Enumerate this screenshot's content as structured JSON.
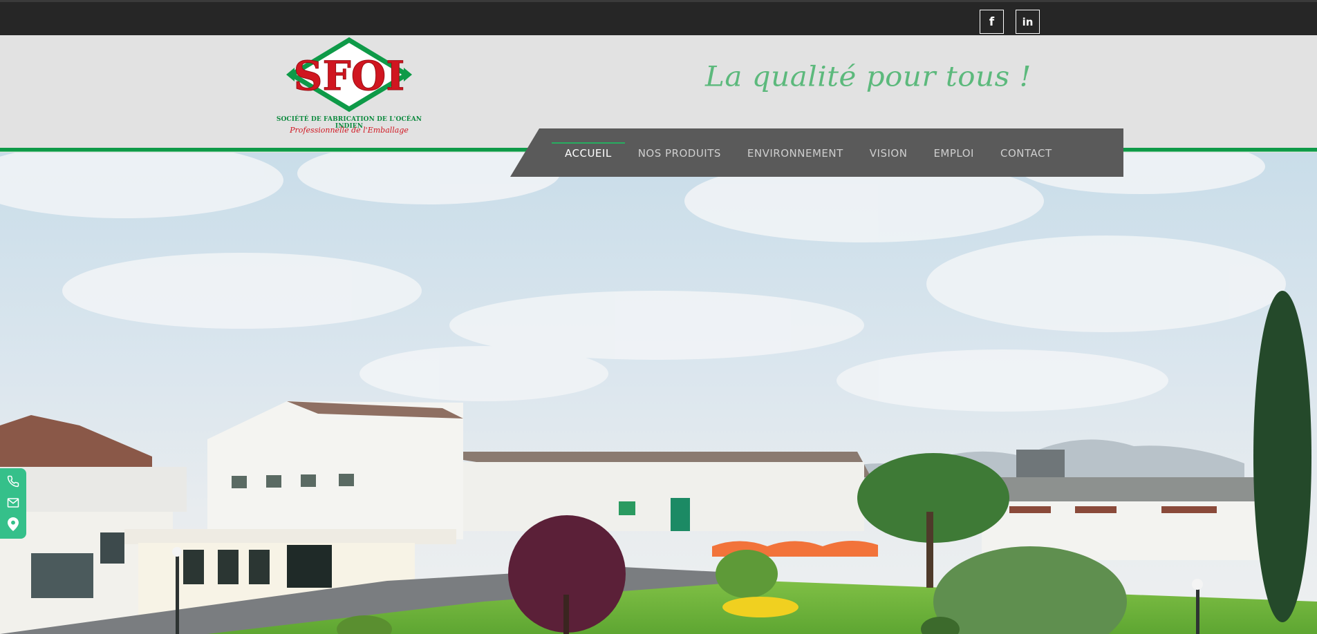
{
  "social": {
    "facebook": {
      "label": "f",
      "icon": "facebook-icon"
    },
    "linkedin": {
      "label": "in",
      "icon": "linkedin-icon"
    }
  },
  "logo": {
    "name": "SFOI",
    "tagline": "SOCIÉTÉ DE FABRICATION DE L'OCÉAN INDIEN",
    "subtitle": "Professionnelle de l'Emballage"
  },
  "header": {
    "slogan": "La qualité pour tous !"
  },
  "nav": {
    "items": [
      {
        "label": "ACCUEIL",
        "active": true
      },
      {
        "label": "NOS PRODUITS",
        "active": false
      },
      {
        "label": "ENVIRONNEMENT",
        "active": false
      },
      {
        "label": "VISION",
        "active": false
      },
      {
        "label": "EMPLOI",
        "active": false
      },
      {
        "label": "CONTACT",
        "active": false
      }
    ]
  },
  "side_widget": {
    "icons": [
      "phone-icon",
      "mail-icon",
      "location-pin-icon"
    ]
  },
  "colors": {
    "topbar": "#262626",
    "header_bg": "#e2e2e2",
    "brand_green": "#0e9a48",
    "brand_red": "#d01620",
    "nav_bg": "#5a5a5a",
    "widget_green": "#35c08a"
  }
}
